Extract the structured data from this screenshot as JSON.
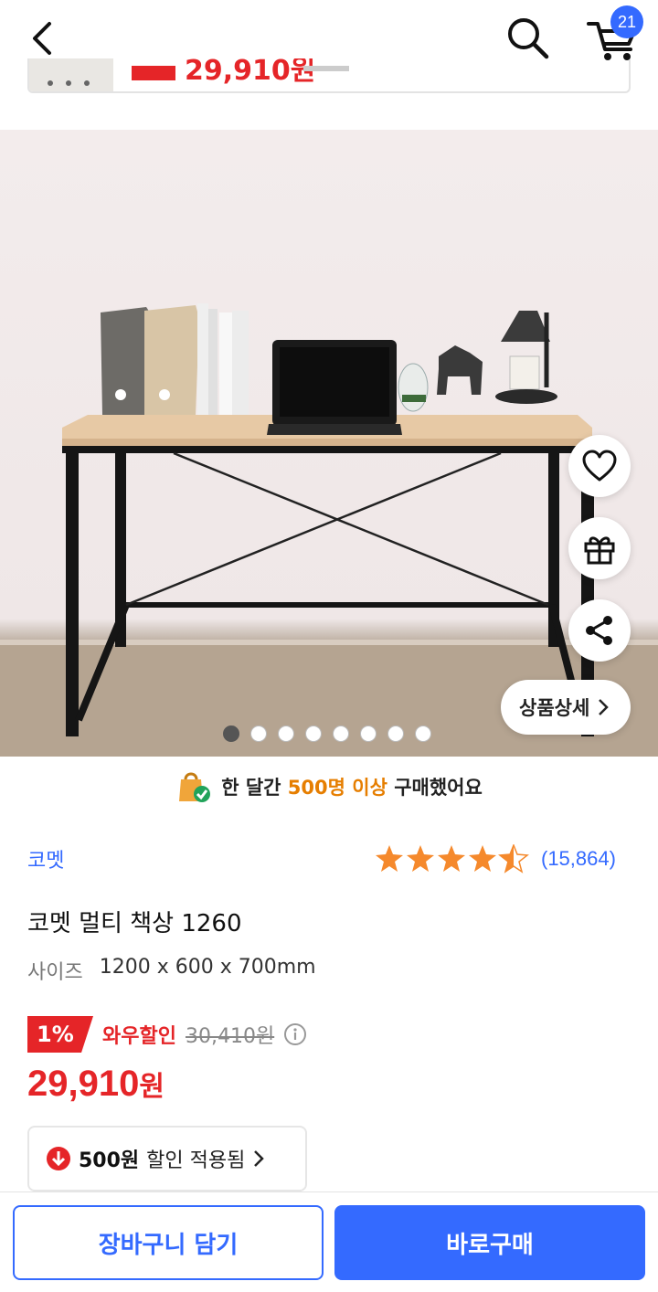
{
  "header": {
    "cart_count": "21",
    "sticky_price_peek": "29,910원"
  },
  "gallery": {
    "total_images": 8,
    "active_index": 0,
    "detail_button_label": "상품상세"
  },
  "social_proof": {
    "prefix": "한 달간",
    "highlight": "500명 이상",
    "suffix": "구매했어요"
  },
  "product": {
    "brand": "코멧",
    "rating_stars": 4.5,
    "review_count": "(15,864)",
    "title": "코멧 멀티 책상 1260",
    "option_key": "사이즈",
    "option_value": "1200 x 600 x 700mm",
    "discount_rate": "1%",
    "discount_label": "와우할인",
    "original_price": "30,410원",
    "price_number": "29,910",
    "price_unit": "원"
  },
  "coupon": {
    "amount": "500원",
    "text": "할인 적용됨"
  },
  "bottom": {
    "add_to_cart": "장바구니 담기",
    "buy_now": "바로구매"
  },
  "colors": {
    "accent_blue": "#346aff",
    "sale_red": "#e52528",
    "star_orange": "#f5892c",
    "highlight_orange": "#e67e00"
  }
}
